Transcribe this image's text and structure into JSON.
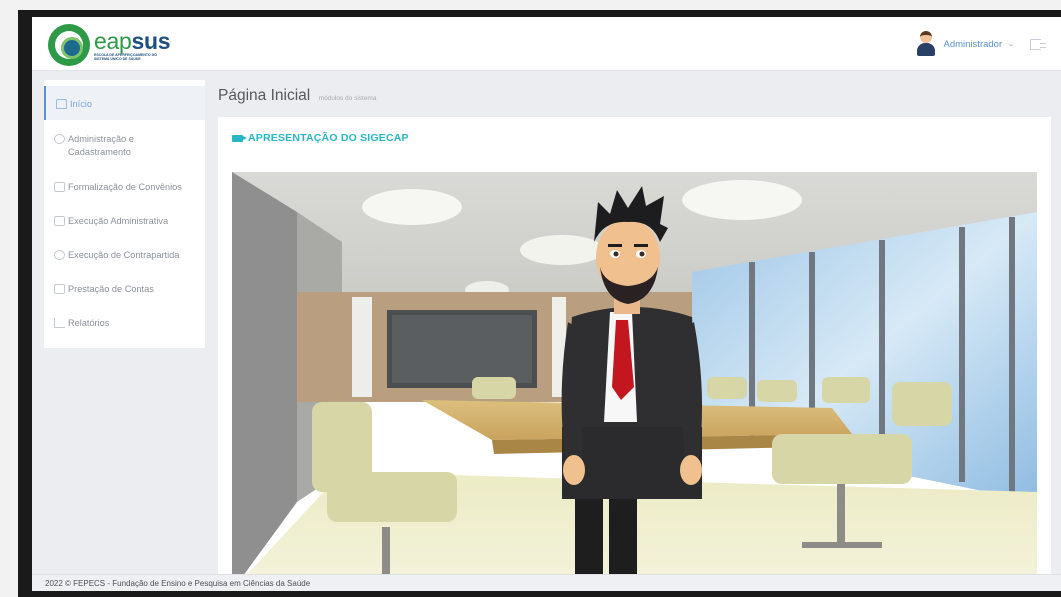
{
  "header": {
    "logo": {
      "word_eap": "eap",
      "word_sus": "sus",
      "subtitle": "ESCOLA DE APERFEIÇOAMENTO DO SISTEMA ÚNICO DE SAÚDE"
    },
    "user": {
      "name": "Administrador",
      "chevron": "⌄",
      "avatar_icon": "user-avatar-icon",
      "logout_icon": "logout-icon"
    }
  },
  "sidebar": {
    "items": [
      {
        "label": "Início",
        "icon": "home-icon",
        "active": true
      },
      {
        "label": "Administração e Cadastramento",
        "icon": "cog-icon",
        "active": false
      },
      {
        "label": "Formalização de Convênios",
        "icon": "folder-icon",
        "active": false
      },
      {
        "label": "Execução Administrativa",
        "icon": "window-icon",
        "active": false
      },
      {
        "label": "Execução de Contrapartida",
        "icon": "cog-icon",
        "active": false
      },
      {
        "label": "Prestação de Contas",
        "icon": "file-icon",
        "active": false
      },
      {
        "label": "Relatórios",
        "icon": "chart-icon",
        "active": false
      }
    ]
  },
  "page": {
    "title": "Página Inicial",
    "subtitle": "módulos do sistema"
  },
  "panel": {
    "heading": "APRESENTAÇÃO DO SIGECAP",
    "icon": "video-camera-icon"
  },
  "footer": {
    "text": "2022 © FEPECS - Fundação de Ensino e Pesquisa em Ciências da Saúde"
  },
  "colors": {
    "accent": "#28b6c7",
    "link": "#5b8fd8",
    "brand_green": "#2e9a48",
    "brand_blue": "#1d4f82"
  }
}
